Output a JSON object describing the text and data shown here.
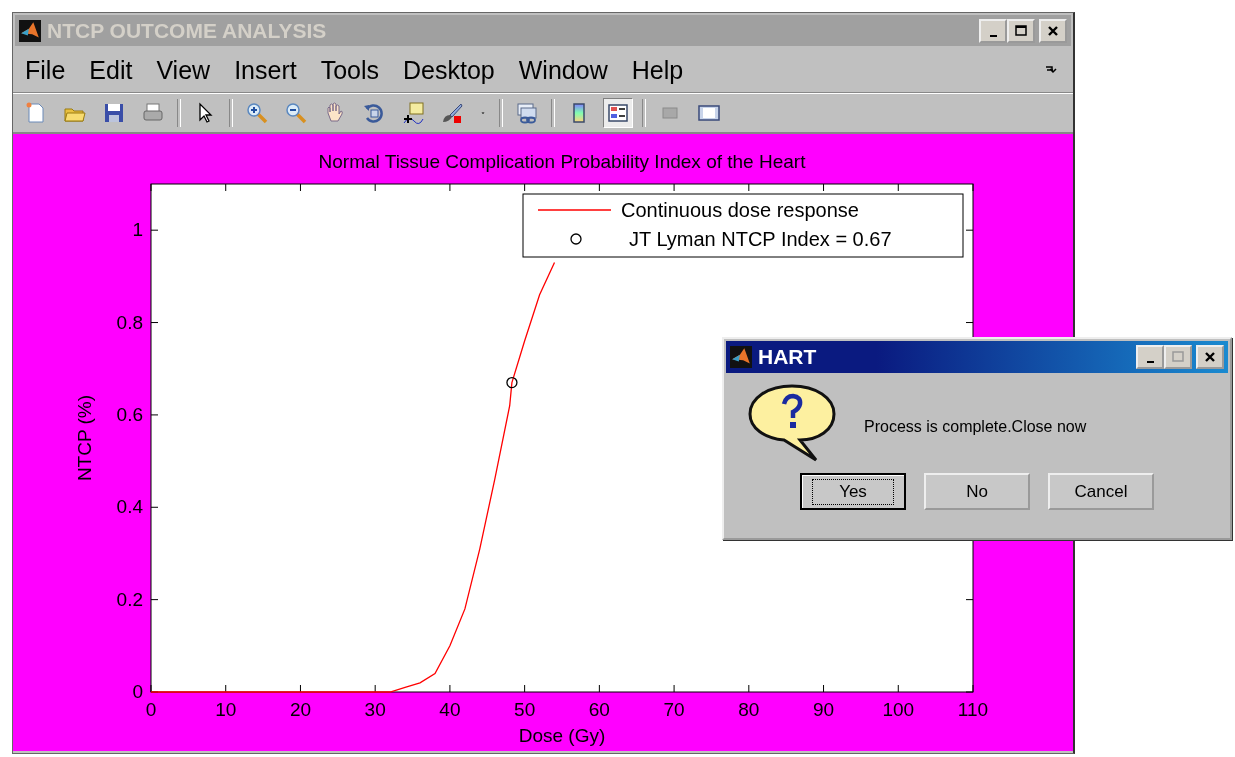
{
  "window": {
    "title": "NTCP OUTCOME ANALYSIS",
    "active": false
  },
  "menu": [
    "File",
    "Edit",
    "View",
    "Insert",
    "Tools",
    "Desktop",
    "Window",
    "Help"
  ],
  "toolbar": [
    {
      "kind": "new",
      "pressed": false
    },
    {
      "kind": "open",
      "pressed": false
    },
    {
      "kind": "save",
      "pressed": false
    },
    {
      "kind": "print",
      "pressed": false
    },
    {
      "kind": "separator"
    },
    {
      "kind": "pointer",
      "pressed": false
    },
    {
      "kind": "separator"
    },
    {
      "kind": "zoom-in",
      "pressed": false
    },
    {
      "kind": "zoom-out",
      "pressed": false
    },
    {
      "kind": "pan",
      "pressed": false
    },
    {
      "kind": "rotate",
      "pressed": false
    },
    {
      "kind": "data-cursor",
      "pressed": false
    },
    {
      "kind": "brush",
      "pressed": false
    },
    {
      "kind": "caret",
      "pressed": false
    },
    {
      "kind": "separator"
    },
    {
      "kind": "link",
      "pressed": false
    },
    {
      "kind": "separator"
    },
    {
      "kind": "colorbar",
      "pressed": false
    },
    {
      "kind": "legend",
      "pressed": true
    },
    {
      "kind": "separator"
    },
    {
      "kind": "hide-tools",
      "pressed": false
    },
    {
      "kind": "show-tools",
      "pressed": false
    }
  ],
  "figure": {
    "chart_data": {
      "type": "line",
      "title": "Normal Tissue Complication Probability Index of the Heart",
      "xlabel": "Dose (Gy)",
      "ylabel": "NTCP (%)",
      "x": [
        0,
        10,
        20,
        30,
        32,
        34,
        36,
        38,
        40,
        42,
        44,
        46,
        48,
        48.3,
        50,
        52,
        54
      ],
      "series": [
        {
          "name": "Continuous dose response",
          "color": "#ff0000",
          "values": [
            0,
            0,
            0,
            0,
            0,
            0.01,
            0.02,
            0.04,
            0.1,
            0.18,
            0.31,
            0.46,
            0.62,
            0.67,
            0.76,
            0.86,
            0.93
          ]
        },
        {
          "name": "JT Lyman NTCP Index = 0.67",
          "color": "#000000",
          "marker": "o",
          "values": [
            null,
            null,
            null,
            null,
            null,
            null,
            null,
            null,
            null,
            null,
            null,
            null,
            null,
            0.67,
            null,
            null,
            null
          ]
        }
      ],
      "legend": true,
      "xlim": [
        0,
        110
      ],
      "ylim": [
        0,
        1.1
      ],
      "xticks": [
        0,
        10,
        20,
        30,
        40,
        50,
        60,
        70,
        80,
        90,
        100,
        110
      ],
      "yticks": [
        0,
        0.2,
        0.4,
        0.6,
        0.8,
        1
      ]
    }
  },
  "dialog": {
    "title": "HART",
    "message": "Process is complete.Close now",
    "buttons": [
      {
        "label": "Yes",
        "focused": true
      },
      {
        "label": "No",
        "focused": false
      },
      {
        "label": "Cancel",
        "focused": false
      }
    ]
  }
}
